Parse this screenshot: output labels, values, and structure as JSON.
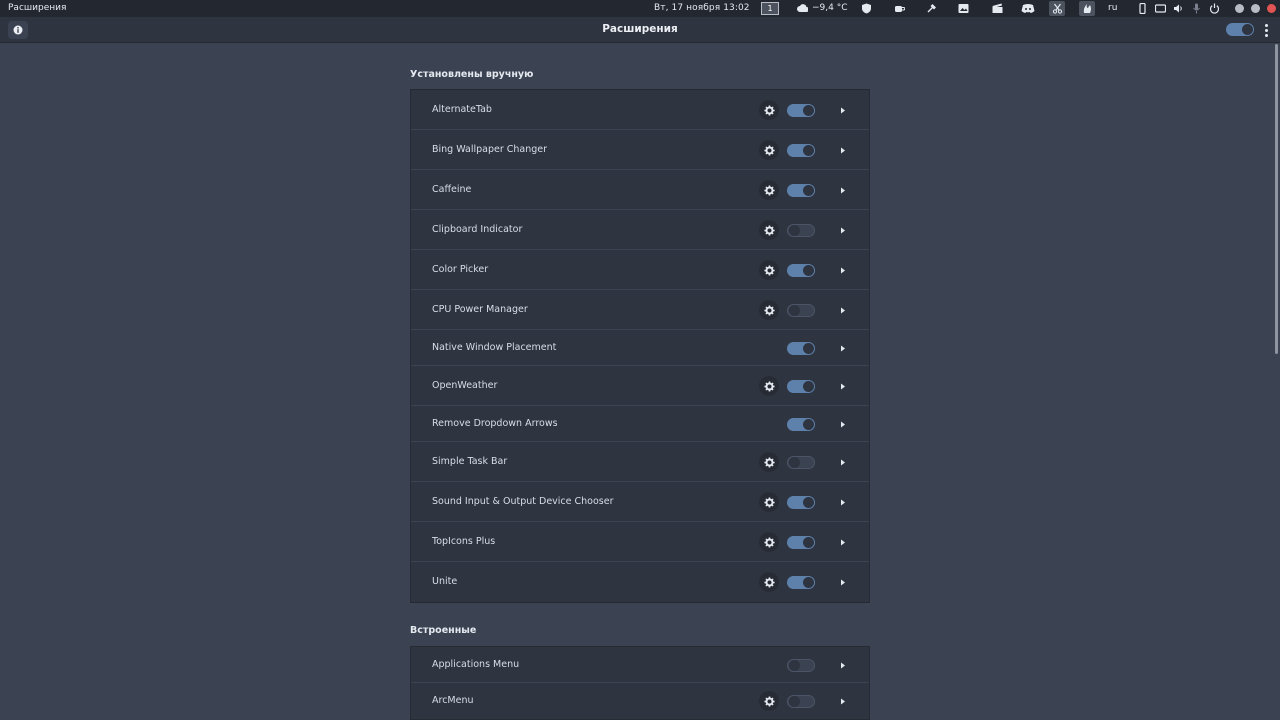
{
  "top_panel": {
    "app_name": "Расширения",
    "clock": "Вт, 17 ноября  13:02",
    "workspace": "1",
    "weather": "−9,4 °C",
    "lang": "ru"
  },
  "header": {
    "title": "Расширения"
  },
  "sections": {
    "manual": {
      "title": "Установлены вручную",
      "items": [
        {
          "name": "AlternateTab",
          "enabled": true,
          "has_settings": true
        },
        {
          "name": "Bing Wallpaper Changer",
          "enabled": true,
          "has_settings": true
        },
        {
          "name": "Caffeine",
          "enabled": true,
          "has_settings": true
        },
        {
          "name": "Clipboard Indicator",
          "enabled": false,
          "has_settings": true
        },
        {
          "name": "Color Picker",
          "enabled": true,
          "has_settings": true
        },
        {
          "name": "CPU Power Manager",
          "enabled": false,
          "has_settings": true
        },
        {
          "name": "Native Window Placement",
          "enabled": true,
          "has_settings": false
        },
        {
          "name": "OpenWeather",
          "enabled": true,
          "has_settings": true
        },
        {
          "name": "Remove Dropdown Arrows",
          "enabled": true,
          "has_settings": false
        },
        {
          "name": "Simple Task Bar",
          "enabled": false,
          "has_settings": true
        },
        {
          "name": "Sound Input & Output Device Chooser",
          "enabled": true,
          "has_settings": true
        },
        {
          "name": "TopIcons Plus",
          "enabled": true,
          "has_settings": true
        },
        {
          "name": "Unite",
          "enabled": true,
          "has_settings": true
        }
      ]
    },
    "builtin": {
      "title": "Встроенные",
      "items": [
        {
          "name": "Applications Menu",
          "enabled": false,
          "has_settings": false
        },
        {
          "name": "ArcMenu",
          "enabled": false,
          "has_settings": true
        }
      ]
    }
  },
  "colors": {
    "accent": "#5e81ac",
    "background": "#3b4252",
    "row_bg": "#2e3440",
    "panel_bg": "#23272f"
  }
}
